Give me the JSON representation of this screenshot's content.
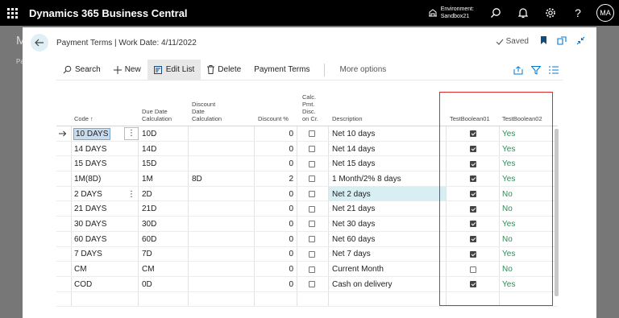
{
  "app": {
    "title": "Dynamics 365 Business Central",
    "environment_label": "Environment:",
    "environment_name": "Sandbox21",
    "user_initials": "MA"
  },
  "background": {
    "letter": "M",
    "sub": "Pa"
  },
  "dialog": {
    "title": "Payment Terms | Work Date: 4/11/2022",
    "status": "Saved"
  },
  "toolbar": {
    "search": "Search",
    "new": "New",
    "edit_list": "Edit List",
    "delete": "Delete",
    "payment_terms": "Payment Terms",
    "more_options": "More options"
  },
  "columns": {
    "code": "Code",
    "due_date": [
      "Due Date",
      "Calculation"
    ],
    "discount_date": [
      "Discount",
      "Date",
      "Calculation"
    ],
    "discount_pct": "Discount %",
    "calc_pmt": [
      "Calc.",
      "Pmt.",
      "Disc.",
      "on Cr."
    ],
    "description": "Description",
    "tb1": "TestBoolean01",
    "tb2": "TestBoolean02"
  },
  "rows": [
    {
      "code": "10 DAYS",
      "due": "10D",
      "disc_date": "",
      "disc_pct": "0",
      "calc": false,
      "desc": "Net 10 days",
      "tb1": true,
      "tb2": "Yes"
    },
    {
      "code": "14 DAYS",
      "due": "14D",
      "disc_date": "",
      "disc_pct": "0",
      "calc": false,
      "desc": "Net 14 days",
      "tb1": true,
      "tb2": "Yes"
    },
    {
      "code": "15 DAYS",
      "due": "15D",
      "disc_date": "",
      "disc_pct": "0",
      "calc": false,
      "desc": "Net 15 days",
      "tb1": true,
      "tb2": "Yes"
    },
    {
      "code": "1M(8D)",
      "due": "1M",
      "disc_date": "8D",
      "disc_pct": "2",
      "calc": false,
      "desc": "1 Month/2% 8 days",
      "tb1": true,
      "tb2": "Yes"
    },
    {
      "code": "2 DAYS",
      "due": "2D",
      "disc_date": "",
      "disc_pct": "0",
      "calc": false,
      "desc": "Net 2 days",
      "tb1": true,
      "tb2": "No"
    },
    {
      "code": "21 DAYS",
      "due": "21D",
      "disc_date": "",
      "disc_pct": "0",
      "calc": false,
      "desc": "Net 21 days",
      "tb1": true,
      "tb2": "No"
    },
    {
      "code": "30 DAYS",
      "due": "30D",
      "disc_date": "",
      "disc_pct": "0",
      "calc": false,
      "desc": "Net 30 days",
      "tb1": true,
      "tb2": "Yes"
    },
    {
      "code": "60 DAYS",
      "due": "60D",
      "disc_date": "",
      "disc_pct": "0",
      "calc": false,
      "desc": "Net 60 days",
      "tb1": true,
      "tb2": "No"
    },
    {
      "code": "7 DAYS",
      "due": "7D",
      "disc_date": "",
      "disc_pct": "0",
      "calc": false,
      "desc": "Net 7 days",
      "tb1": true,
      "tb2": "Yes"
    },
    {
      "code": "CM",
      "due": "CM",
      "disc_date": "",
      "disc_pct": "0",
      "calc": false,
      "desc": "Current Month",
      "tb1": false,
      "tb2": "No"
    },
    {
      "code": "COD",
      "due": "0D",
      "disc_date": "",
      "disc_pct": "0",
      "calc": false,
      "desc": "Cash on delivery",
      "tb1": true,
      "tb2": "Yes"
    }
  ],
  "colors": {
    "accent": "#0078d4",
    "yes_no": "#2e8b57",
    "highlight_border": "#e0282f"
  },
  "icons": [
    "waffle-icon",
    "environment-icon",
    "search-icon",
    "bell-icon",
    "gear-icon",
    "help-icon",
    "back-arrow-icon",
    "check-icon",
    "bookmark-icon",
    "open-new-icon",
    "collapse-icon",
    "plus-icon",
    "edit-list-icon",
    "trash-icon",
    "share-icon",
    "filter-icon",
    "list-view-icon",
    "row-arrow-icon",
    "row-menu-icon",
    "sort-up-icon"
  ]
}
